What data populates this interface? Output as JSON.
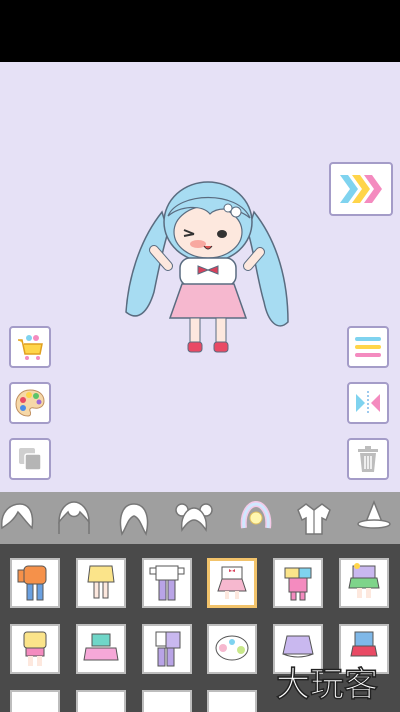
{
  "watermark": {
    "text": "大玩客"
  },
  "colors": {
    "stage_bg": "#e6e1f6",
    "tab_bar_bg": "#9f9f9f",
    "grid_bg": "#4a4a4a",
    "selected_border": "#f2c36b",
    "button_border": "#a49cc8",
    "hair": "#a7dcf2",
    "skirt": "#f6b8cf"
  },
  "buttons": {
    "next": {
      "icon": "triple-chevron-right-icon"
    },
    "shop": {
      "icon": "shopping-cart-icon"
    },
    "palette": {
      "icon": "palette-icon"
    },
    "layers": {
      "icon": "layers-icon"
    },
    "menu": {
      "icon": "hamburger-menu-icon"
    },
    "flip": {
      "icon": "flip-horizontal-icon"
    },
    "trash": {
      "icon": "trash-icon"
    }
  },
  "category_tabs": [
    {
      "icon": "hair-front-icon"
    },
    {
      "icon": "hair-bangs-icon"
    },
    {
      "icon": "hair-back-icon"
    },
    {
      "icon": "hair-buns-icon"
    },
    {
      "icon": "hair-accessory-icon",
      "selected": true
    },
    {
      "icon": "jacket-icon"
    },
    {
      "icon": "hat-icon"
    }
  ],
  "outfits": [
    {
      "icon": "orange-hoodie-outfit"
    },
    {
      "icon": "yellow-dress-outfit"
    },
    {
      "icon": "white-shirt-purple-pants-outfit"
    },
    {
      "icon": "pink-skirt-outfit",
      "selected": true
    },
    {
      "icon": "pink-overalls-outfit"
    },
    {
      "icon": "green-skirt-outfit"
    },
    {
      "icon": "yellow-sweater-pink-shorts-outfit"
    },
    {
      "icon": "teal-top-pink-skirt-outfit"
    },
    {
      "icon": "white-top-purple-pants-outfit"
    },
    {
      "icon": "white-lace-dress-outfit"
    },
    {
      "icon": "purple-skirt-outfit"
    },
    {
      "icon": "blue-top-red-skirt-outfit"
    }
  ]
}
